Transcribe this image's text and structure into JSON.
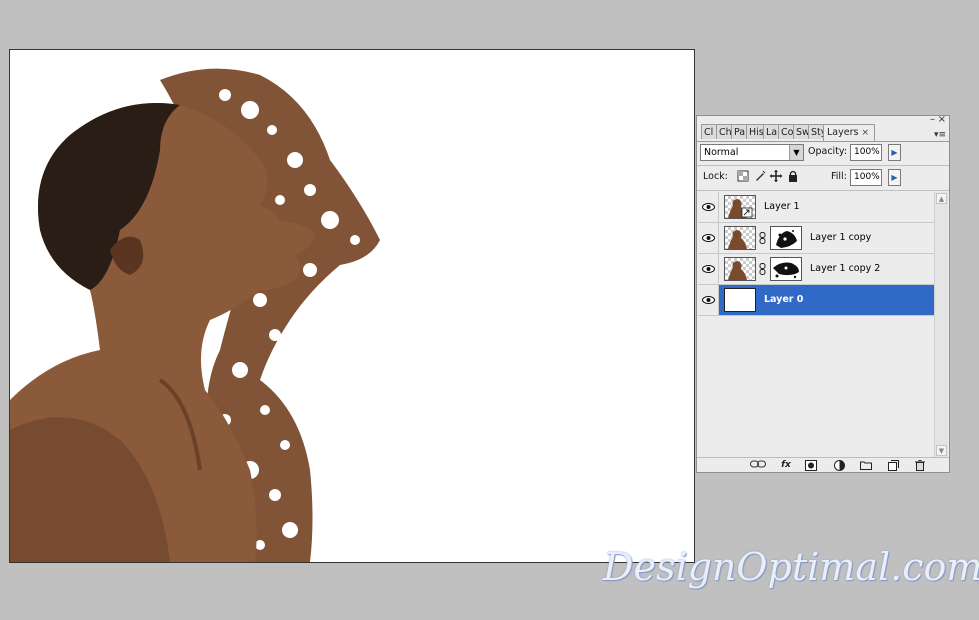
{
  "panel": {
    "tabs": [
      {
        "label": "Cl",
        "icon": "tab-clone-source"
      },
      {
        "label": "Ch",
        "icon": "tab-channels"
      },
      {
        "label": "Pa",
        "icon": "tab-paths"
      },
      {
        "label": "His",
        "icon": "tab-history"
      },
      {
        "label": "La",
        "icon": "tab-layer-comps"
      },
      {
        "label": "Co",
        "icon": "tab-color"
      },
      {
        "label": "Sw",
        "icon": "tab-swatches"
      },
      {
        "label": "Sty",
        "icon": "tab-styles"
      },
      {
        "label": "Layers",
        "icon": "tab-layers",
        "active": true
      }
    ],
    "tab_close": "×",
    "blend_mode": "Normal",
    "opacity_label": "Opacity:",
    "opacity_value": "100%",
    "lock_label": "Lock:",
    "fill_label": "Fill:",
    "fill_value": "100%",
    "layers": [
      {
        "name": "Layer 1",
        "has_mask": false,
        "smart_object": true,
        "selected": false
      },
      {
        "name": "Layer 1 copy",
        "has_mask": true,
        "selected": false
      },
      {
        "name": "Layer 1 copy 2",
        "has_mask": true,
        "selected": false
      },
      {
        "name": "Layer 0",
        "has_mask": false,
        "selected": true
      }
    ],
    "bottom_icons": [
      "link-layers-icon",
      "fx-icon",
      "add-mask-icon",
      "adjustment-layer-icon",
      "new-group-icon",
      "new-layer-icon",
      "trash-icon"
    ],
    "fx_label": "fx"
  },
  "colors": {
    "selection": "#3169c6",
    "skin": "#8a5a3a",
    "background": "#c0c0c0"
  },
  "watermark": "DesignOptimal.com"
}
